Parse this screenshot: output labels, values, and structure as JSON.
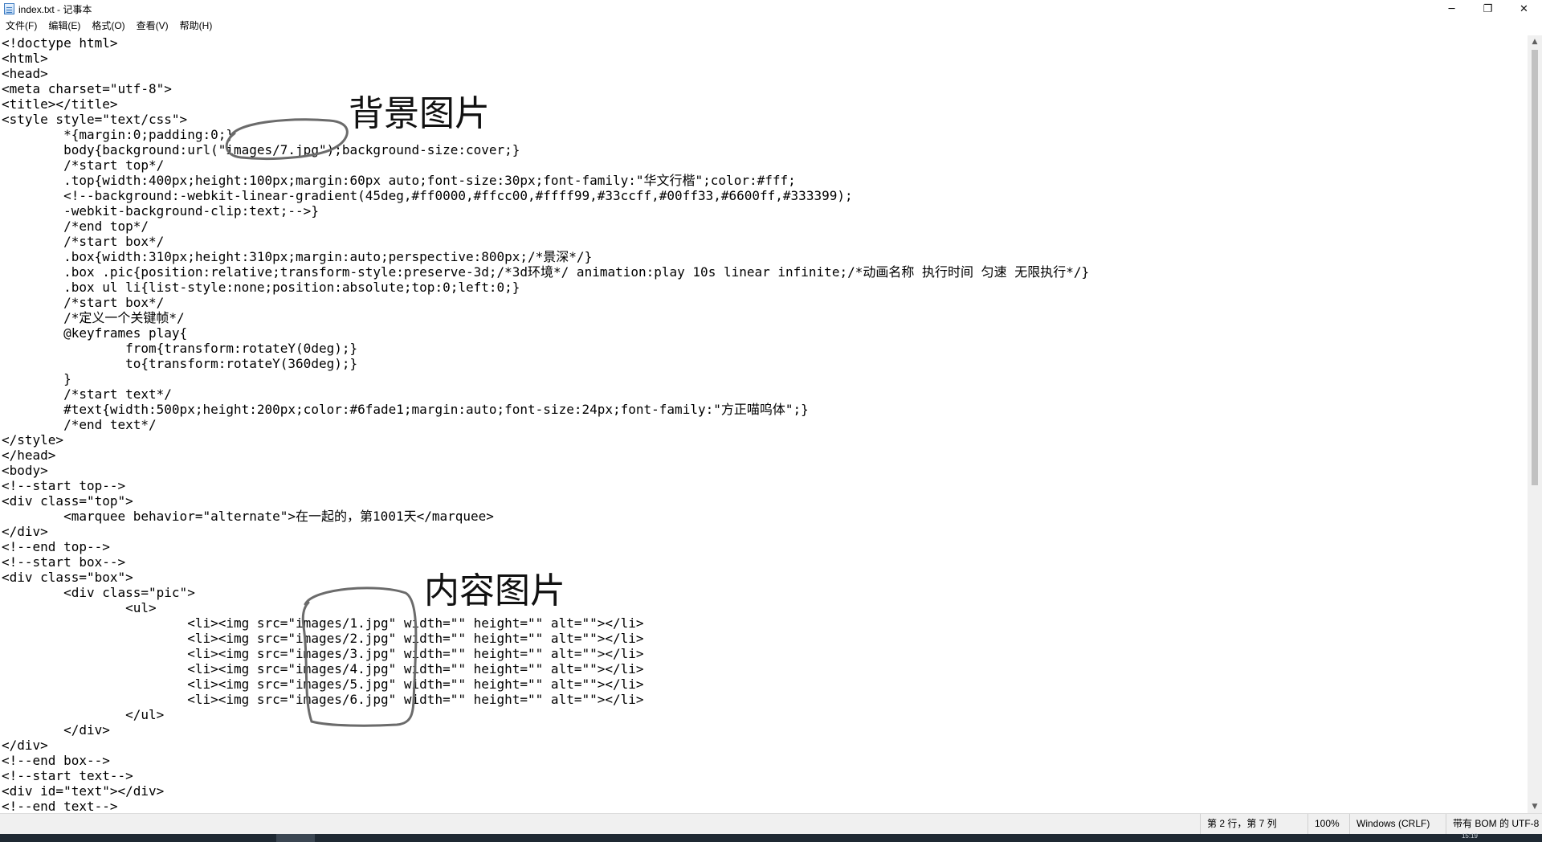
{
  "window": {
    "title": "index.txt - 记事本",
    "controls": {
      "minimize": "─",
      "restore": "❐",
      "close": "✕"
    }
  },
  "menu": [
    "文件(F)",
    "编辑(E)",
    "格式(O)",
    "查看(V)",
    "帮助(H)"
  ],
  "editor": {
    "lines": [
      "<!doctype html>",
      "<html>",
      "<head>",
      "<meta charset=\"utf-8\">",
      "<title></title>",
      "<style style=\"text/css\">",
      "\t*{margin:0;padding:0;}",
      "\tbody{background:url(\"images/7.jpg\");background-size:cover;}",
      "\t/*start top*/",
      "\t.top{width:400px;height:100px;margin:60px auto;font-size:30px;font-family:\"华文行楷\";color:#fff;",
      "\t<!--background:-webkit-linear-gradient(45deg,#ff0000,#ffcc00,#ffff99,#33ccff,#00ff33,#6600ff,#333399);",
      "\t-webkit-background-clip:text;-->}",
      "\t/*end top*/",
      "\t/*start box*/",
      "\t.box{width:310px;height:310px;margin:auto;perspective:800px;/*景深*/}",
      "\t.box .pic{position:relative;transform-style:preserve-3d;/*3d环境*/ animation:play 10s linear infinite;/*动画名称 执行时间 匀速 无限执行*/}",
      "\t.box ul li{list-style:none;position:absolute;top:0;left:0;}",
      "\t/*start box*/",
      "\t/*定义一个关键帧*/",
      "\t@keyframes play{",
      "\t\tfrom{transform:rotateY(0deg);}",
      "\t\tto{transform:rotateY(360deg);}",
      "\t}",
      "\t/*start text*/",
      "\t#text{width:500px;height:200px;color:#6fade1;margin:auto;font-size:24px;font-family:\"方正喵呜体\";}",
      "\t/*end text*/",
      "</style>",
      "</head>",
      "<body>",
      "<!--start top-->",
      "<div class=\"top\">",
      "\t<marquee behavior=\"alternate\">在一起的，第1001天</marquee>",
      "</div>",
      "<!--end top-->",
      "<!--start box-->",
      "<div class=\"box\">",
      "\t<div class=\"pic\">",
      "\t\t<ul>",
      "\t\t\t<li><img src=\"images/1.jpg\" width=\"\" height=\"\" alt=\"\"></li>",
      "\t\t\t<li><img src=\"images/2.jpg\" width=\"\" height=\"\" alt=\"\"></li>",
      "\t\t\t<li><img src=\"images/3.jpg\" width=\"\" height=\"\" alt=\"\"></li>",
      "\t\t\t<li><img src=\"images/4.jpg\" width=\"\" height=\"\" alt=\"\"></li>",
      "\t\t\t<li><img src=\"images/5.jpg\" width=\"\" height=\"\" alt=\"\"></li>",
      "\t\t\t<li><img src=\"images/6.jpg\" width=\"\" height=\"\" alt=\"\"></li>",
      "\t\t</ul>",
      "\t</div>",
      "</div>",
      "<!--end box-->",
      "<!--start text-->",
      "<div id=\"text\"></div>",
      "<!--end text-->"
    ]
  },
  "annotations": {
    "background_label": "背景图片",
    "content_label": "内容图片",
    "ink_color": "#6b6b6b"
  },
  "status": {
    "position": "第 2 行，第 7 列",
    "zoom": "100%",
    "line_ending": "Windows (CRLF)",
    "encoding": "带有 BOM 的 UTF-8"
  },
  "taskbar": {
    "clock": "15:19"
  }
}
